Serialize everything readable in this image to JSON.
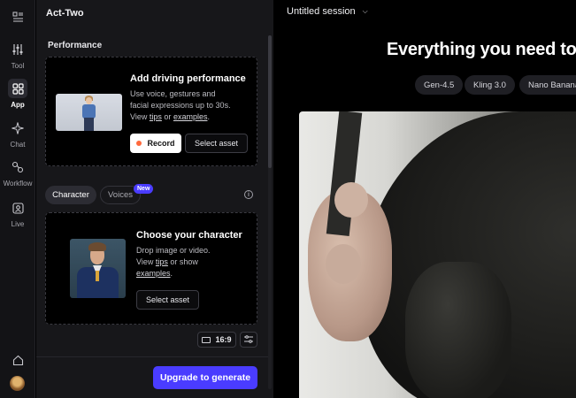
{
  "rail": {
    "items": [
      {
        "label": "Tool",
        "icon": "sliders-icon"
      },
      {
        "label": "App",
        "icon": "apps-grid-icon",
        "active": true
      },
      {
        "label": "Chat",
        "icon": "chat-icon"
      },
      {
        "label": "Workflow",
        "icon": "workflow-icon"
      },
      {
        "label": "Live",
        "icon": "live-icon"
      }
    ]
  },
  "panel": {
    "title": "Act-Two",
    "performance": {
      "section_label": "Performance",
      "heading": "Add driving performance",
      "line1": "Use voice, gestures and",
      "line2": "facial expressions up to 30s.",
      "view": "View",
      "tips": "tips",
      "or": "or",
      "examples": "examples",
      "period": ".",
      "record_label": "Record",
      "select_label": "Select asset"
    },
    "tabs": {
      "character": "Character",
      "voices": "Voices",
      "new_badge": "New"
    },
    "character": {
      "heading": "Choose your character",
      "line1": "Drop image or video.",
      "view": "View",
      "tips": "tips",
      "or_show": "or show",
      "examples": "examples",
      "period": ".",
      "select_label": "Select asset"
    },
    "aspect_ratio": "16:9",
    "upgrade_label": "Upgrade to generate"
  },
  "main": {
    "session_title": "Untitled session",
    "hero_text": "Everything you need to",
    "chips": [
      "Gen-4.5",
      "Kling 3.0",
      "Nano Banana"
    ]
  },
  "colors": {
    "accent": "#4a3cff",
    "record_dot": "#ff6a3d",
    "background": "#000000",
    "panel": "#17171a"
  }
}
